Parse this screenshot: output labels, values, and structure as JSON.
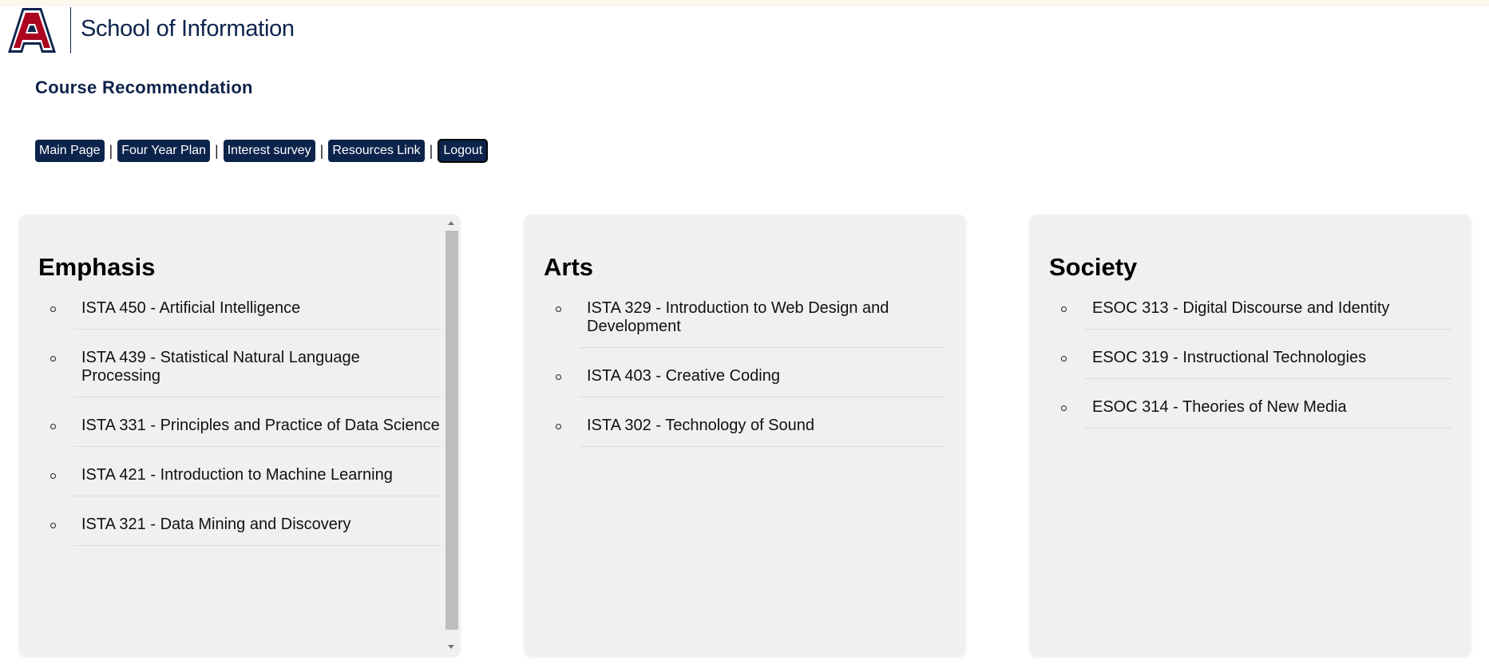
{
  "header": {
    "logo_letter": "A",
    "school_name": "School of Information"
  },
  "page": {
    "title": "Course Recommendation"
  },
  "nav": {
    "main_page": "Main Page",
    "four_year_plan": "Four Year Plan",
    "interest_survey": "Interest survey",
    "resources_link": "Resources Link",
    "logout": "Logout",
    "separator": "|"
  },
  "panels": [
    {
      "title": "Emphasis",
      "courses": [
        "ISTA 450 - Artificial Intelligence",
        "ISTA 439 - Statistical Natural Language Processing",
        "ISTA 331 - Principles and Practice of Data Science",
        "ISTA 421 - Introduction to Machine Learning",
        "ISTA 321 - Data Mining and Discovery"
      ]
    },
    {
      "title": "Arts",
      "courses": [
        "ISTA 329 - Introduction to Web Design and Development",
        "ISTA 403 - Creative Coding",
        "ISTA 302 - Technology of Sound"
      ]
    },
    {
      "title": "Society",
      "courses": [
        "ESOC 313 - Digital Discourse and Identity",
        "ESOC 319 - Instructional Technologies",
        "ESOC 314 - Theories of New Media"
      ]
    }
  ],
  "colors": {
    "brand_navy": "#0c234b",
    "brand_red": "#ab0520",
    "panel_bg": "#f0f0f0"
  }
}
